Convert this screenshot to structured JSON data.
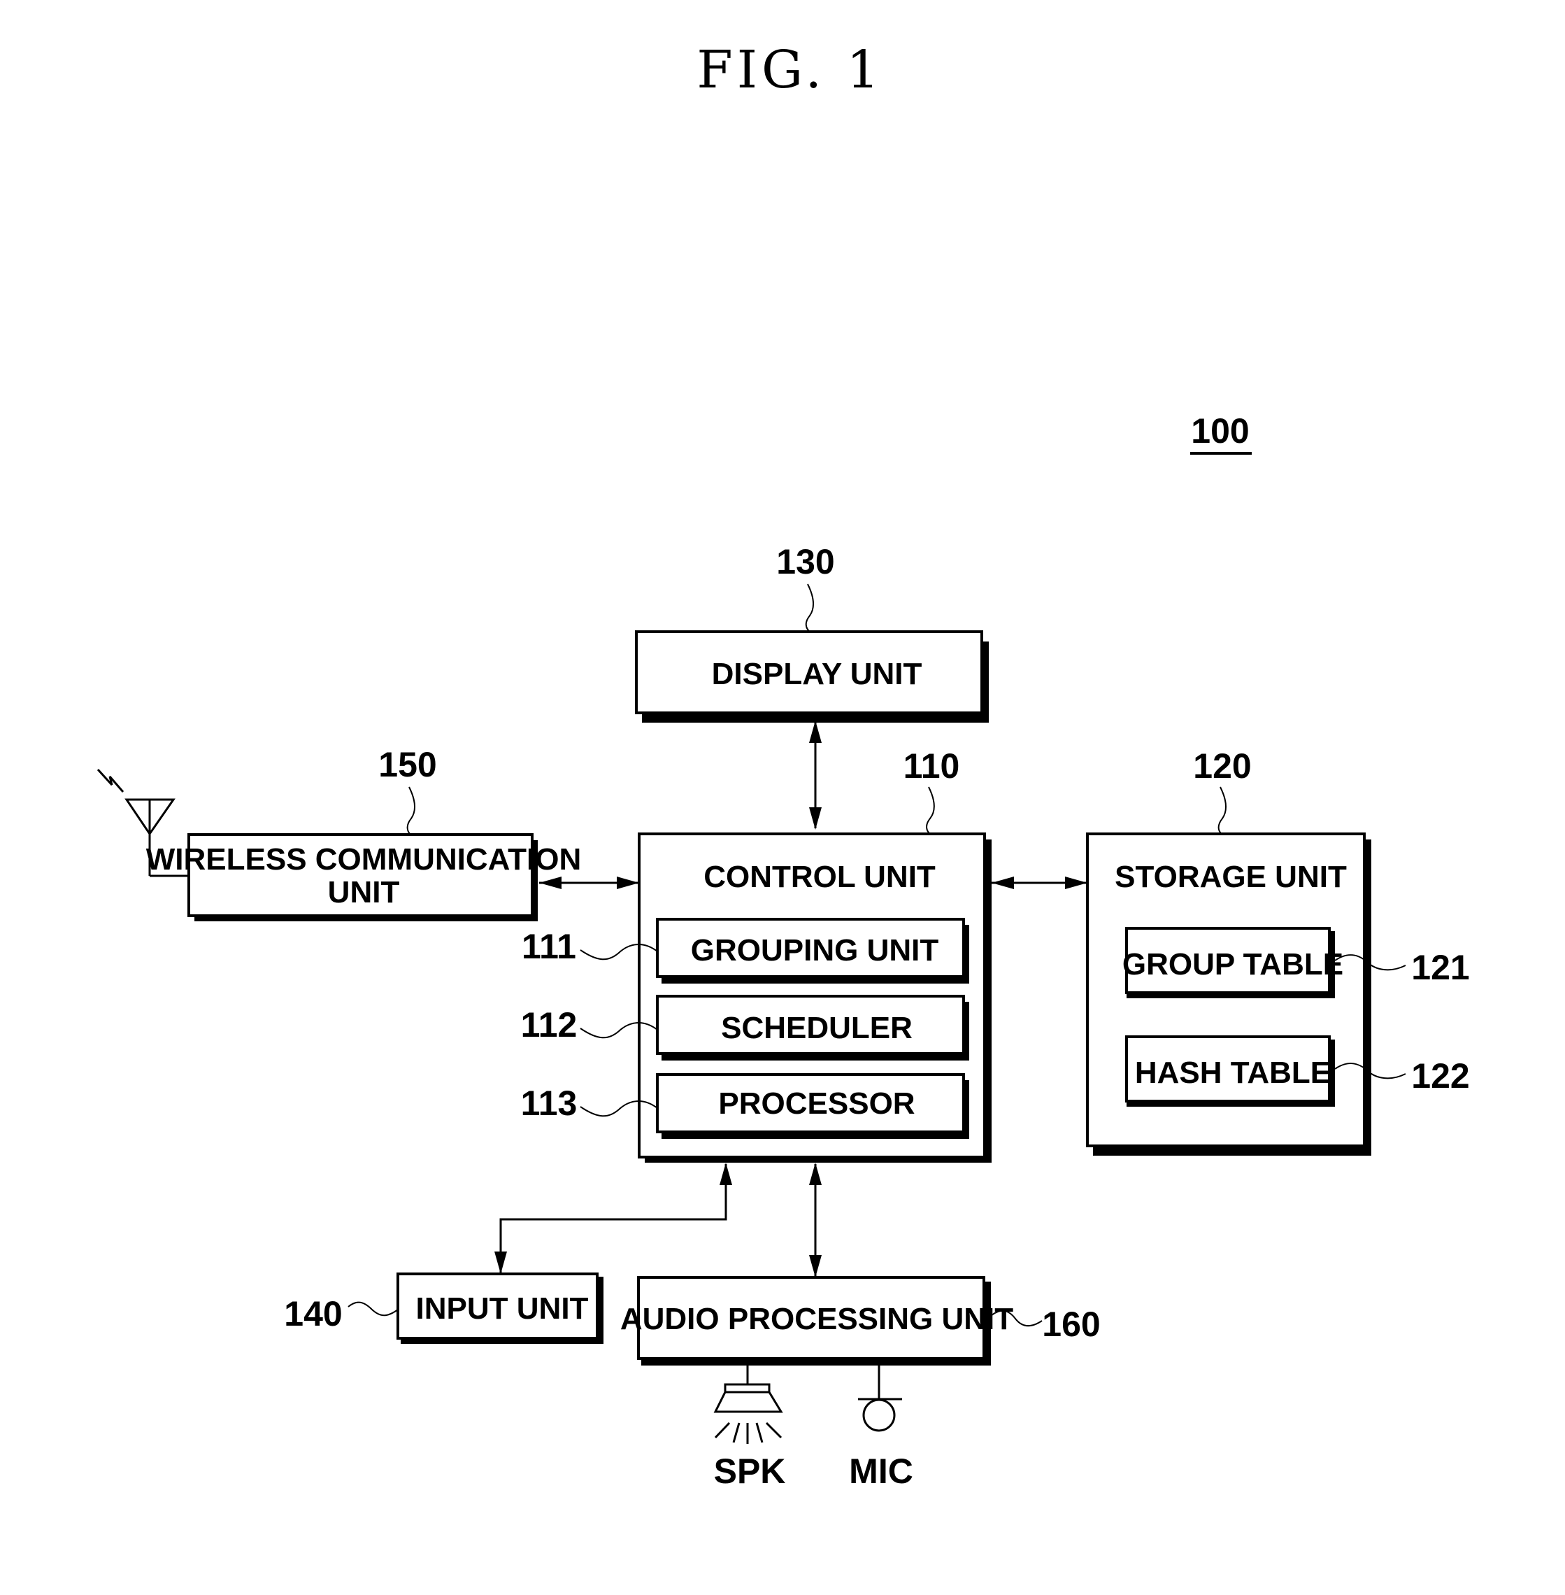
{
  "figure": {
    "title": "FIG. 1",
    "device_ref": "100"
  },
  "blocks": {
    "display": {
      "ref": "130",
      "label": "DISPLAY UNIT"
    },
    "control": {
      "ref": "110",
      "label": "CONTROL UNIT",
      "sub": [
        {
          "ref": "111",
          "label": "GROUPING UNIT"
        },
        {
          "ref": "112",
          "label": "SCHEDULER"
        },
        {
          "ref": "113",
          "label": "PROCESSOR"
        }
      ]
    },
    "storage": {
      "ref": "120",
      "label": "STORAGE UNIT",
      "sub": [
        {
          "ref": "121",
          "label": "GROUP TABLE"
        },
        {
          "ref": "122",
          "label": "HASH TABLE"
        }
      ]
    },
    "wireless": {
      "ref": "150",
      "label_line1": "WIRELESS COMMUNICATION",
      "label_line2": "UNIT"
    },
    "input": {
      "ref": "140",
      "label": "INPUT UNIT"
    },
    "audio": {
      "ref": "160",
      "label": "AUDIO PROCESSING UNIT"
    }
  },
  "peripherals": {
    "speaker": {
      "label": "SPK",
      "icon": "speaker-icon"
    },
    "mic": {
      "label": "MIC",
      "icon": "microphone-icon"
    },
    "antenna": {
      "icon": "antenna-icon"
    }
  }
}
